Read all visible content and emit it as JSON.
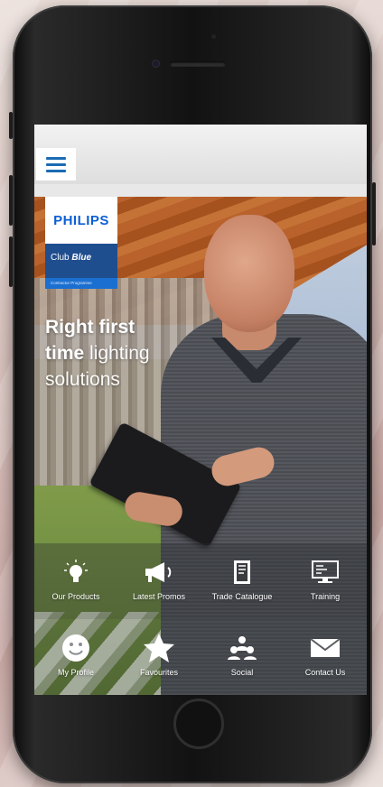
{
  "app": {
    "brand": "PHILIPS",
    "program_name_prefix": "Club",
    "program_name_emphasis": "Blue",
    "program_strip": "Contractor Programme"
  },
  "hero": {
    "line1_bold": "Right first",
    "line2_bold": "time",
    "line2_light": "lighting",
    "line3_light": "solutions"
  },
  "tiles_row1": [
    {
      "label": "Our Products",
      "icon": "lightbulb-icon"
    },
    {
      "label": "Latest Promos",
      "icon": "megaphone-icon"
    },
    {
      "label": "Trade Catalogue",
      "icon": "catalogue-book-icon"
    },
    {
      "label": "Training",
      "icon": "monitor-icon"
    }
  ],
  "tiles_row2": [
    {
      "label": "My Profile",
      "icon": "smiley-face-icon"
    },
    {
      "label": "Favourites",
      "icon": "star-icon"
    },
    {
      "label": "Social",
      "icon": "people-group-icon"
    },
    {
      "label": "Contact Us",
      "icon": "envelope-icon"
    }
  ],
  "colors": {
    "brand_blue": "#0b5ed7",
    "program_blue": "#1f4e8f",
    "menu_icon": "#1a6bb3"
  }
}
